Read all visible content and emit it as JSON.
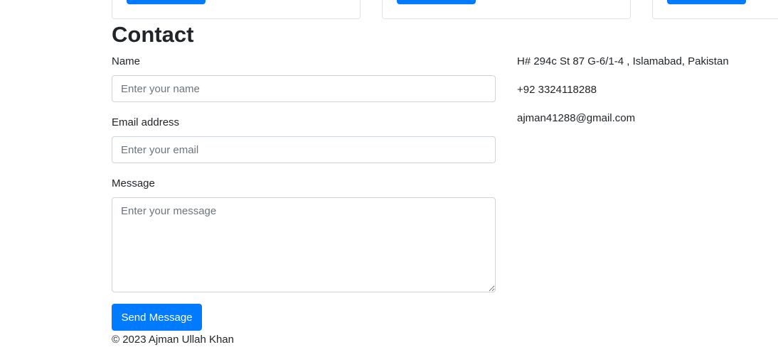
{
  "contact": {
    "heading": "Contact",
    "form": {
      "name_label": "Name",
      "name_placeholder": "Enter your name",
      "email_label": "Email address",
      "email_placeholder": "Enter your email",
      "message_label": "Message",
      "message_placeholder": "Enter your message",
      "submit_label": "Send Message"
    },
    "info": {
      "address": "H# 294c St 87 G-6/1-4 , Islamabad, Pakistan",
      "phone": "+92 3324118288",
      "email": "ajman41288@gmail.com"
    }
  },
  "footer": {
    "copyright": "© 2023 Ajman Ullah Khan"
  },
  "colors": {
    "primary": "#007bff",
    "text": "#212529",
    "border": "#ced4da"
  }
}
